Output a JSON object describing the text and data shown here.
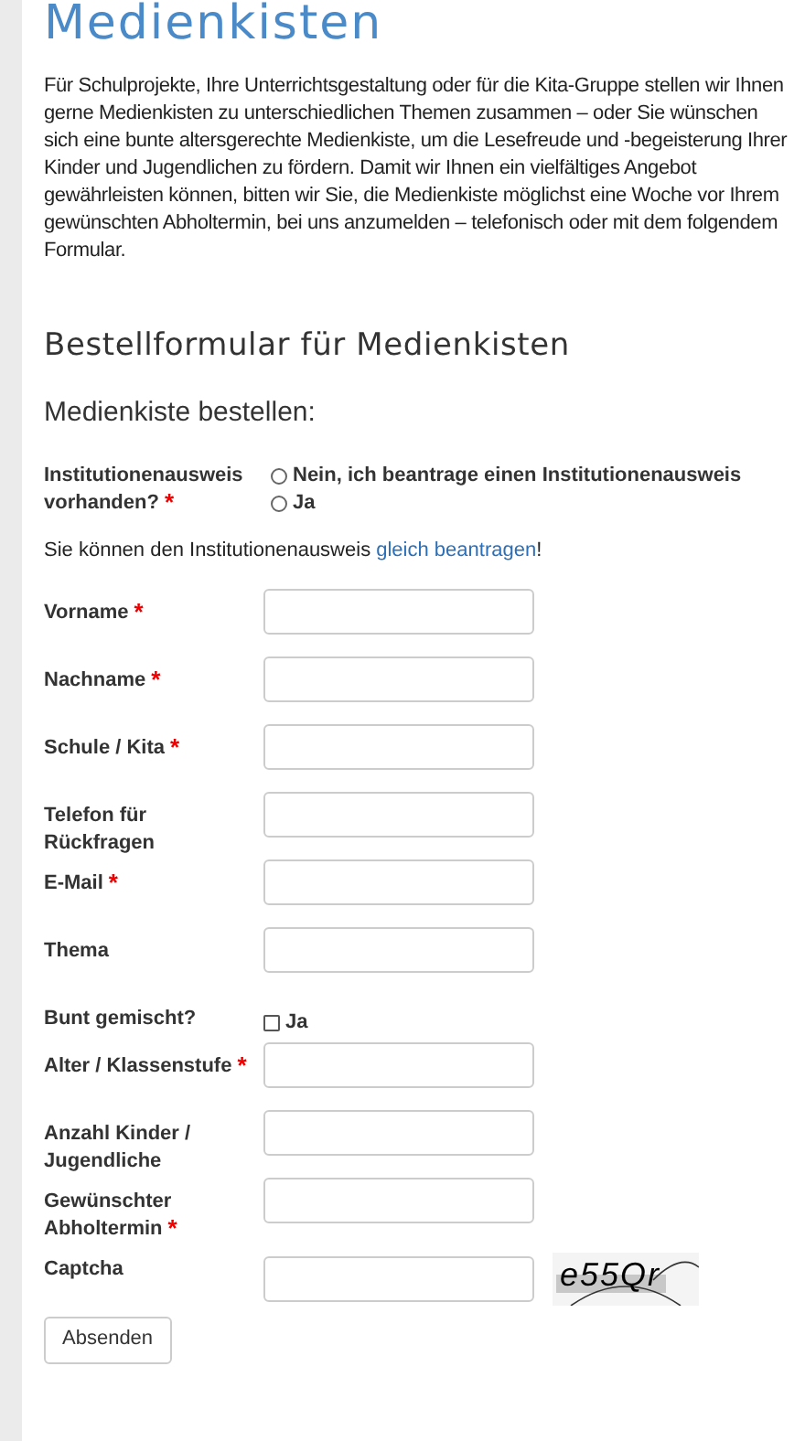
{
  "title": "Medienkisten",
  "intro": "Für Schulprojekte, Ihre Unterrichtsgestaltung oder für die Kita-Gruppe stellen wir Ihnen gerne Medienkisten zu unterschiedlichen Themen zusammen – oder Sie wünschen sich eine bunte altersgerechte Medienkiste, um die Lesefreude und -begeisterung Ihrer Kinder und Jugendlichen zu fördern. Damit wir Ihnen ein vielfältiges Angebot gewährleisten können, bitten wir Sie, die Medienkiste möglichst eine Woche vor Ihrem gewünschten Abholtermin, bei uns anzumelden – telefonisch oder mit dem folgendem Formular.",
  "form_heading": "Bestellformular für Medienkisten",
  "form_subheading": "Medienkiste bestellen:",
  "id_question": {
    "label": "Institutionenausweis vorhanden?",
    "required_mark": "*",
    "options": [
      {
        "label": "Nein, ich beantrage einen Institutionenausweis",
        "selected": false
      },
      {
        "label": "Ja",
        "selected": false
      }
    ]
  },
  "note": {
    "text": "Sie können den Institutionenausweis ",
    "link": "gleich beantragen",
    "after": "!"
  },
  "fields": [
    {
      "kind": "text",
      "label": "Vorname",
      "required_mark": "*"
    },
    {
      "kind": "text",
      "label": "Nachname",
      "required_mark": "*"
    },
    {
      "kind": "text",
      "label": "Schule / Kita",
      "required_mark": "*"
    },
    {
      "kind": "text",
      "label": "Telefon für Rückfragen"
    },
    {
      "kind": "text",
      "label": "E-Mail",
      "required_mark": "*"
    },
    {
      "kind": "text",
      "label": "Thema"
    },
    {
      "kind": "checkbox",
      "label": "Bunt gemischt?",
      "option": "Ja",
      "checked": false
    },
    {
      "kind": "text",
      "label": "Alter / Klassenstufe",
      "required_mark": "*"
    },
    {
      "kind": "text",
      "label": "Anzahl Kinder / Jugendliche"
    },
    {
      "kind": "text",
      "label": "Gewünschter Abholtermin",
      "required_mark": "*"
    },
    {
      "kind": "captcha",
      "label": "Captcha",
      "captcha_text": "e55Qr"
    }
  ],
  "submit": "Absenden"
}
